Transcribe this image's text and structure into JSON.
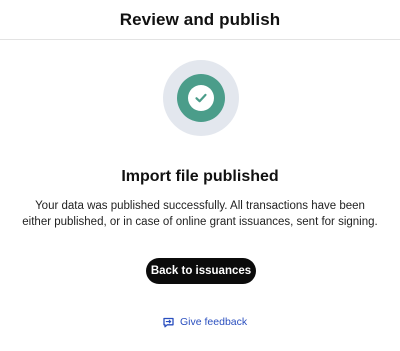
{
  "header": {
    "title": "Review and publish"
  },
  "status": {
    "icon": "check-circle-icon",
    "accent_color": "#4b9d8a",
    "headline": "Import file published",
    "message": "Your data was published successfully. All transactions have been either published, or in case of online grant issuances, sent for signing."
  },
  "actions": {
    "primary_label": "Back to issuances",
    "feedback_label": "Give feedback",
    "feedback_icon": "feedback-icon",
    "link_color": "#2a4fbf"
  }
}
